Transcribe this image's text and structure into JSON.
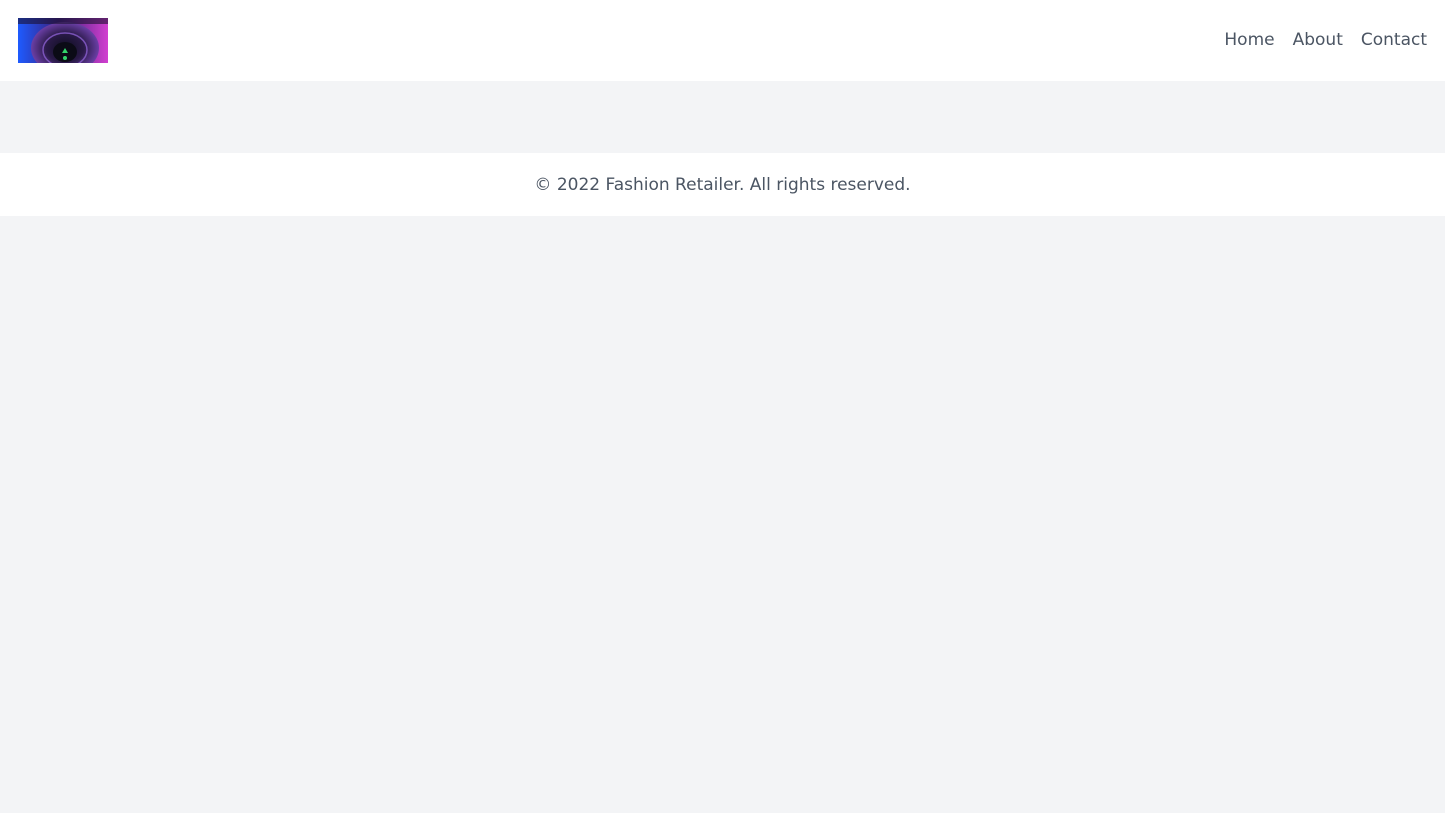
{
  "header": {
    "logo_icon": "camera-lens-logo-icon",
    "nav": [
      {
        "label": "Home"
      },
      {
        "label": "About"
      },
      {
        "label": "Contact"
      }
    ]
  },
  "footer": {
    "copyright": "© 2022 Fashion Retailer. All rights reserved."
  },
  "colors": {
    "page_background": "#f3f4f6",
    "surface": "#ffffff",
    "text": "#4b5563"
  }
}
